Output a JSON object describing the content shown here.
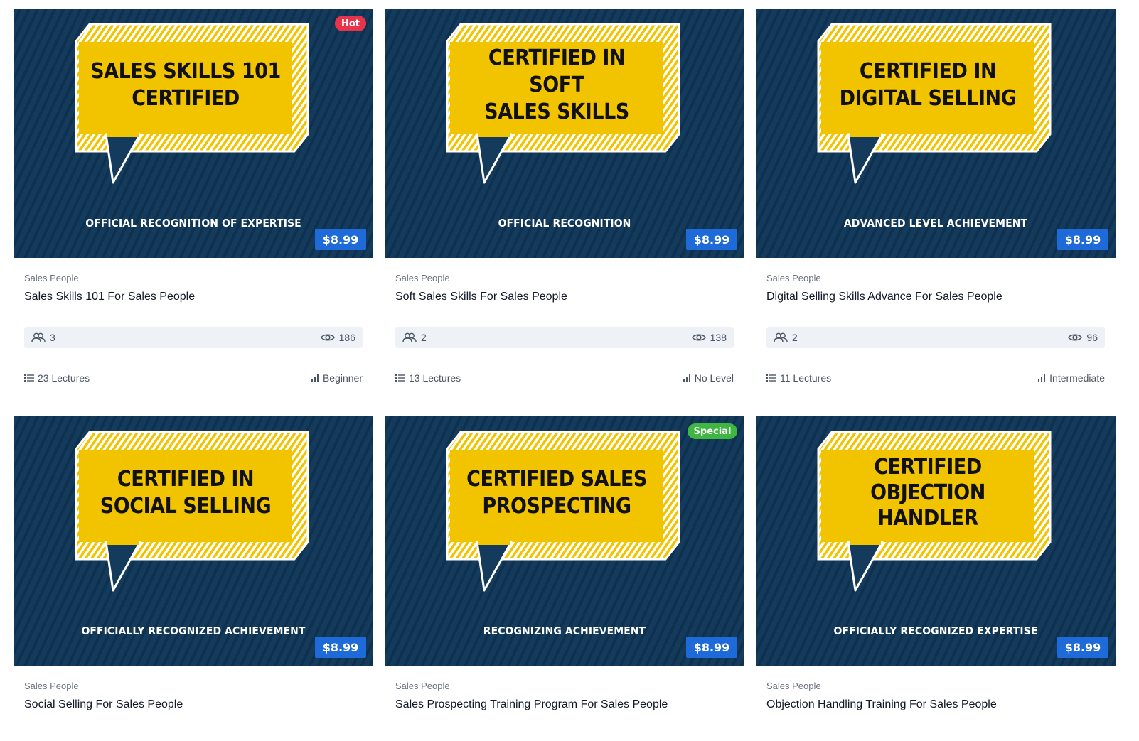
{
  "colors": {
    "thumb_bg": "#143a5c",
    "bubble_yellow": "#f2c400",
    "price_bg": "#1f6ad9",
    "hot_badge": "#e8344b",
    "special_badge": "#3fb542"
  },
  "courses": [
    {
      "headline_line1": "SALES SKILLS 101",
      "headline_line2": "CERTIFIED",
      "headline_line3": "",
      "subtitle": "OFFICIAL RECOGNITION OF EXPERTISE",
      "price": "$8.99",
      "badge": "Hot",
      "category": "Sales People",
      "title": "Sales Skills 101 For Sales People",
      "students": "3",
      "views": "186",
      "lectures": "23 Lectures",
      "level": "Beginner"
    },
    {
      "headline_line1": "CERTIFIED IN SOFT",
      "headline_line2": "SALES SKILLS",
      "headline_line3": "",
      "subtitle": "OFFICIAL RECOGNITION",
      "price": "$8.99",
      "badge": "",
      "category": "Sales People",
      "title": "Soft Sales Skills For Sales People",
      "students": "2",
      "views": "138",
      "lectures": "13 Lectures",
      "level": "No Level"
    },
    {
      "headline_line1": "CERTIFIED IN",
      "headline_line2": "DIGITAL SELLING",
      "headline_line3": "",
      "subtitle": "ADVANCED LEVEL ACHIEVEMENT",
      "price": "$8.99",
      "badge": "",
      "category": "Sales People",
      "title": "Digital Selling Skills Advance For Sales People",
      "students": "2",
      "views": "96",
      "lectures": "11 Lectures",
      "level": "Intermediate"
    },
    {
      "headline_line1": "CERTIFIED IN",
      "headline_line2": "SOCIAL SELLING",
      "headline_line3": "",
      "subtitle": "OFFICIALLY RECOGNIZED ACHIEVEMENT",
      "price": "$8.99",
      "badge": "",
      "category": "Sales People",
      "title": "Social Selling For Sales People"
    },
    {
      "headline_line1": "CERTIFIED SALES",
      "headline_line2": "PROSPECTING",
      "headline_line3": "",
      "subtitle": "RECOGNIZING ACHIEVEMENT",
      "price": "$8.99",
      "badge": "Special",
      "category": "Sales People",
      "title": "Sales Prospecting Training Program For Sales People"
    },
    {
      "headline_line1": "CERTIFIED",
      "headline_line2": "OBJECTION",
      "headline_line3": "HANDLER",
      "subtitle": "OFFICIALLY RECOGNIZED EXPERTISE",
      "price": "$8.99",
      "badge": "",
      "category": "Sales People",
      "title": "Objection Handling Training For Sales People"
    }
  ]
}
